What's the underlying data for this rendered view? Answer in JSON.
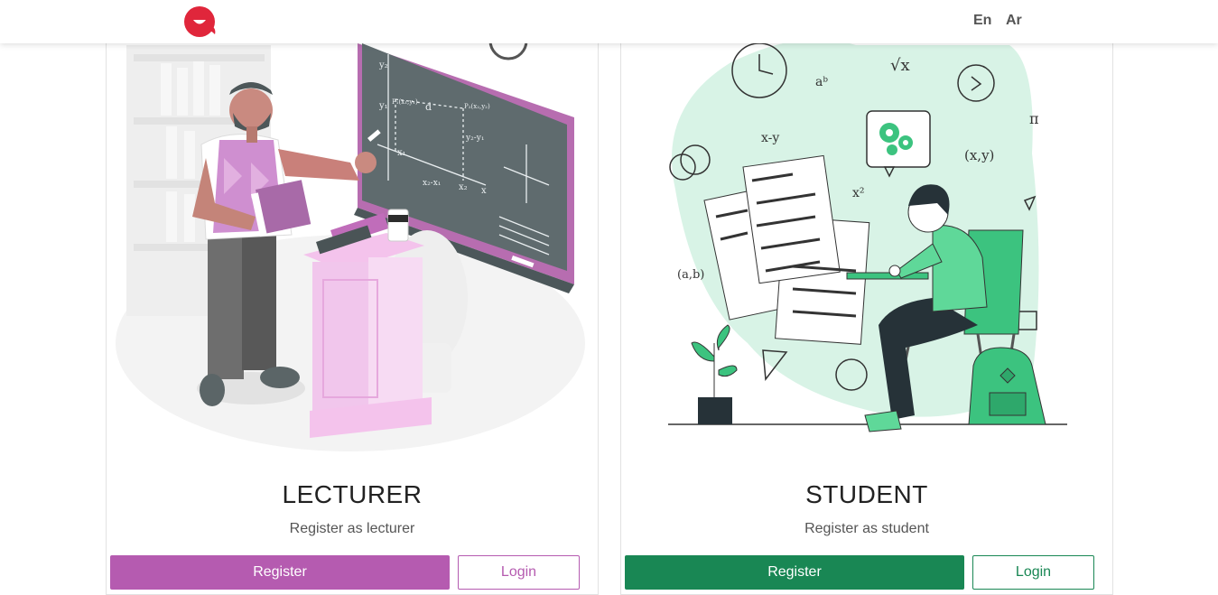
{
  "nav": {
    "logo": "brand-logo",
    "lang_en": "En",
    "lang_ar": "Ar"
  },
  "cards": [
    {
      "title": "LECTURER",
      "subtitle": "Register as lecturer",
      "register_label": "Register",
      "login_label": "Login",
      "accent": "#b55bb0"
    },
    {
      "title": "STUDENT",
      "subtitle": "Register as student",
      "register_label": "Register",
      "login_label": "Login",
      "accent": "#198754"
    }
  ],
  "colors": {
    "brand_red": "#e0263b",
    "lecturer_accent": "#b55bb0",
    "student_accent": "#198754"
  },
  "illustrations": {
    "board_texts": [
      "y₂",
      "y₁",
      "d",
      "x₁",
      "x₂",
      "x",
      "P₁(x₁,y₁)",
      "P₂(x₂,y₂)",
      "y₂-y₁",
      "x₂-x₁"
    ],
    "student_texts": [
      "aᵇ",
      "√x",
      "x-y",
      "π",
      "(x,y)",
      "x²",
      "(a,b)"
    ]
  }
}
